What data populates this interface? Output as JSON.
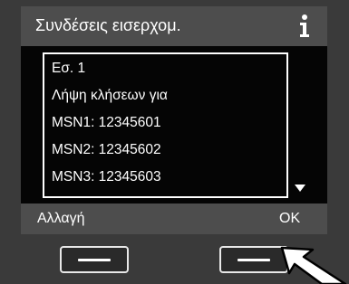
{
  "header": {
    "title": "Συνδέσεις εισερχομ.",
    "info_icon": "info-icon"
  },
  "list": {
    "lines": [
      "Εσ. 1",
      "Λήψη κλήσεων για",
      "MSN1: 12345601",
      "MSN2: 12345602",
      "MSN3: 12345603"
    ]
  },
  "softkeys": {
    "left": "Αλλαγή",
    "right": "OK"
  },
  "icons": {
    "scroll": "scroll-down-arrow-icon",
    "pointer": "pointer-arrow-icon"
  }
}
